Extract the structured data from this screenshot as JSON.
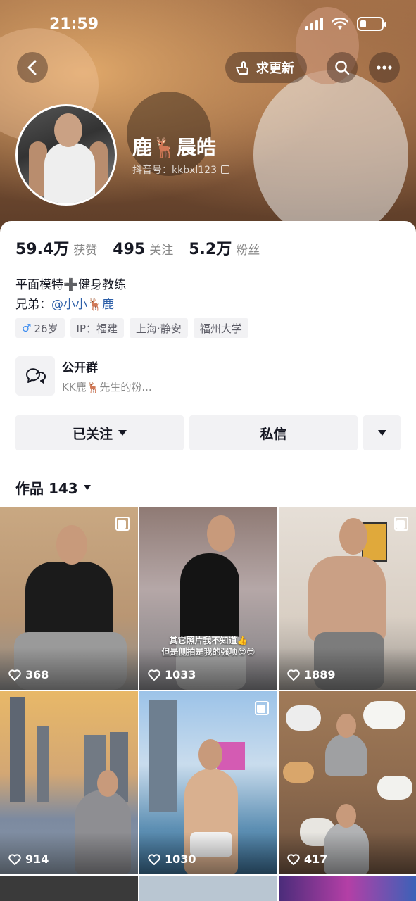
{
  "status": {
    "time": "21:59"
  },
  "header": {
    "update_label": "求更新"
  },
  "profile": {
    "name": "鹿🦌晨皓",
    "douyin_id": "抖音号：kkbxl123"
  },
  "stats": [
    {
      "num": "59.4万",
      "label": "获赞"
    },
    {
      "num": "495",
      "label": "关注"
    },
    {
      "num": "5.2万",
      "label": "粉丝"
    }
  ],
  "bio": {
    "line1": "平面模特➕健身教练",
    "line2_prefix": "兄弟：",
    "line2_link": "@小小🦌鹿"
  },
  "tags": {
    "gender_symbol": "♂",
    "age": "26岁",
    "ip": "IP：福建",
    "location": "上海·静安",
    "school": "福州大学"
  },
  "group": {
    "title": "公开群",
    "subtitle": "KK鹿🦌先生的粉..."
  },
  "actions": {
    "follow": "已关注",
    "message": "私信"
  },
  "works": {
    "label": "作品 143"
  },
  "tiles": [
    {
      "likes": "368",
      "caption": ""
    },
    {
      "likes": "1033",
      "caption": "其它照片我不知道👍\n但是侧拍是我的强项😎😎"
    },
    {
      "likes": "1889",
      "caption": ""
    },
    {
      "likes": "914",
      "caption": ""
    },
    {
      "likes": "1030",
      "caption": ""
    },
    {
      "likes": "417",
      "caption": ""
    }
  ],
  "colors": {
    "link": "#2d5fa8",
    "male": "#3f8ef0",
    "chip_bg": "#f2f2f4"
  }
}
